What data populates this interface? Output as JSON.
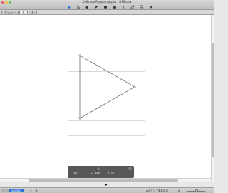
{
  "window": {
    "title": "DMFrosa-Regular.glyphs - DMFrosa",
    "traffic_colors": [
      "#ee5f5b",
      "#f5bf4f",
      "#61c554"
    ]
  },
  "toolbar": {
    "tools": [
      {
        "icon": "select-arrow-icon",
        "active": true
      },
      {
        "icon": "select-all-icon"
      },
      {
        "icon": "draw-pen-icon"
      },
      {
        "icon": "pencil-icon"
      },
      {
        "icon": "ellipse-icon"
      },
      {
        "icon": "rectangle-icon"
      },
      {
        "icon": "text-tool-icon"
      },
      {
        "icon": "measure-icon"
      },
      {
        "icon": "zoom-icon"
      },
      {
        "icon": "hand-icon"
      }
    ],
    "accent": "#2f72d6"
  },
  "tabs": [
    {
      "label": "フォント",
      "active": false
    },
    {
      "label": "A",
      "active": true
    },
    {
      "label": "A",
      "active": false
    }
  ],
  "coord_panel": {
    "x_value": "195",
    "y_value": "550",
    "w_label": "↔ 840",
    "h_label": "↕ 11",
    "panel_title": "A"
  },
  "statusbar": {
    "glyph_name": "Uni0041",
    "layer_text": "",
    "zoom_label": "Aのグリフを表示中",
    "zoom_value": "A",
    "zoom_level": 0.55
  }
}
